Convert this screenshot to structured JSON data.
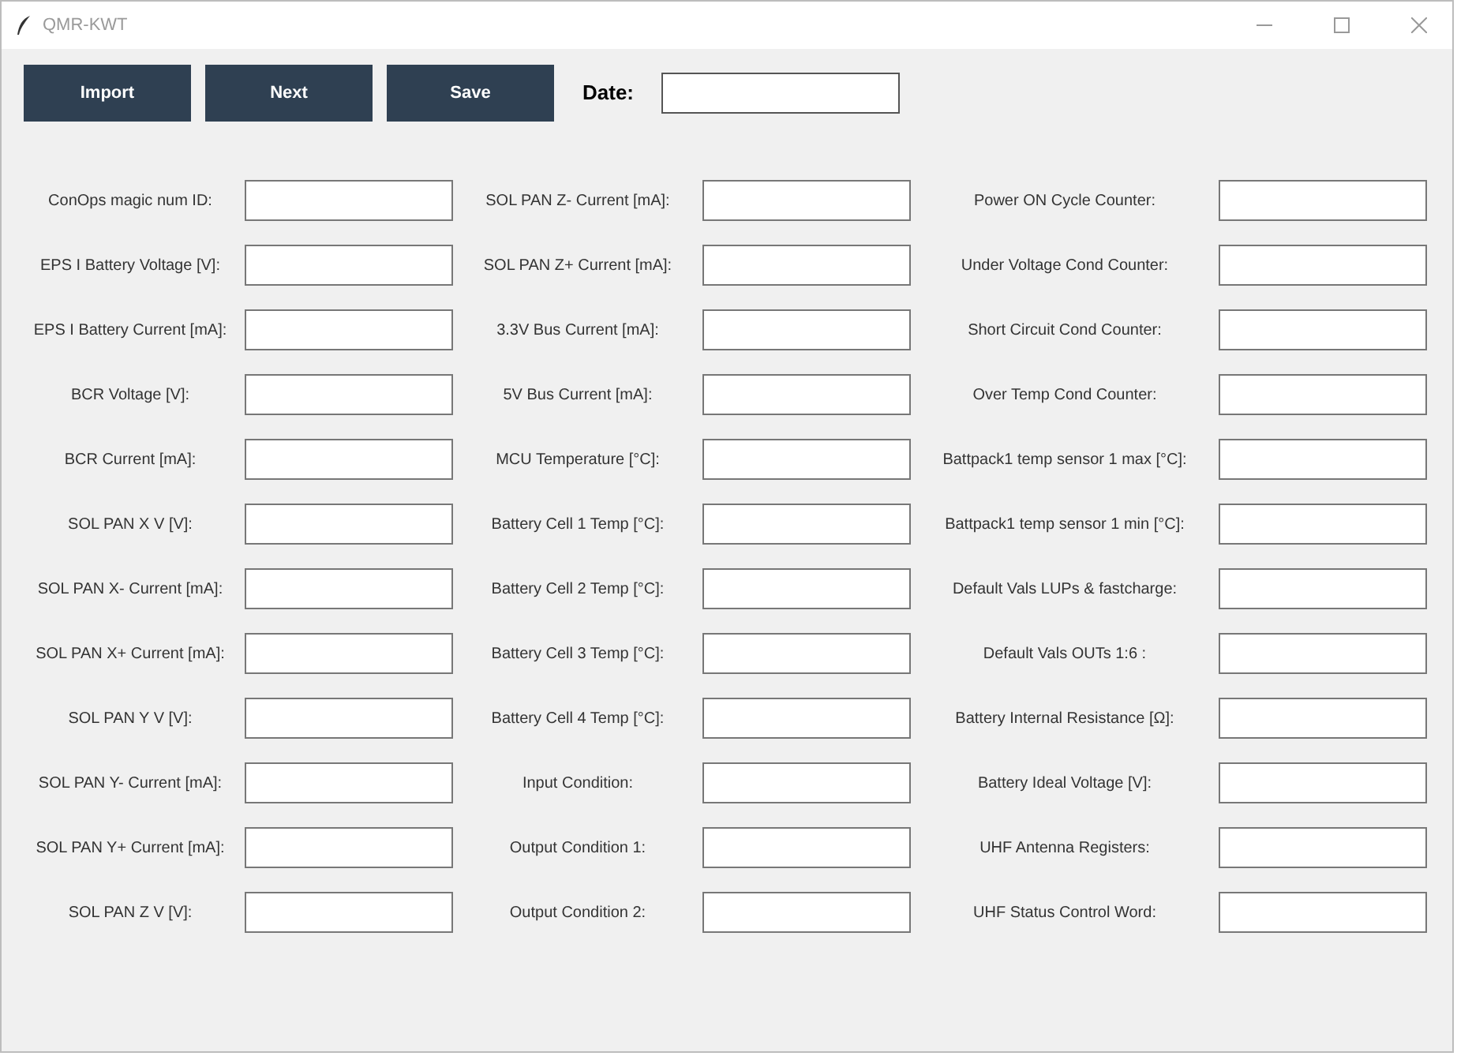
{
  "window": {
    "title": "QMR-KWT"
  },
  "toolbar": {
    "buttons": [
      "Import",
      "Next",
      "Save"
    ],
    "date_label": "Date:"
  },
  "columns": [
    {
      "labels": [
        "ConOps magic num ID:",
        "EPS I Battery Voltage [V]:",
        "EPS I Battery Current [mA]:",
        "BCR Voltage [V]:",
        "BCR Current [mA]:",
        "SOL PAN X V [V]:",
        "SOL PAN X- Current [mA]:",
        "SOL PAN X+ Current [mA]:",
        "SOL PAN Y V [V]:",
        "SOL PAN Y- Current [mA]:",
        "SOL PAN Y+ Current [mA]:",
        "SOL PAN Z V [V]:"
      ]
    },
    {
      "labels": [
        "SOL PAN Z- Current [mA]:",
        "SOL PAN Z+ Current [mA]:",
        "3.3V Bus Current [mA]:",
        "5V Bus Current [mA]:",
        "MCU Temperature [°C]:",
        "Battery Cell 1 Temp [°C]:",
        "Battery Cell 2 Temp [°C]:",
        "Battery Cell 3 Temp [°C]:",
        "Battery Cell 4 Temp [°C]:",
        "Input Condition:",
        "Output Condition 1:",
        "Output Condition 2:"
      ]
    },
    {
      "labels": [
        "Power ON Cycle Counter:",
        "Under Voltage Cond Counter:",
        "Short Circuit Cond Counter:",
        "Over Temp Cond Counter:",
        "Battpack1 temp sensor 1 max [°C]:",
        "Battpack1 temp sensor 1 min [°C]:",
        "Default Vals LUPs & fastcharge:",
        "Default Vals OUTs 1:6 :",
        "Battery Internal Resistance [Ω]:",
        "Battery Ideal Voltage [V]:",
        "UHF Antenna Registers:",
        "UHF Status Control Word:"
      ]
    }
  ]
}
